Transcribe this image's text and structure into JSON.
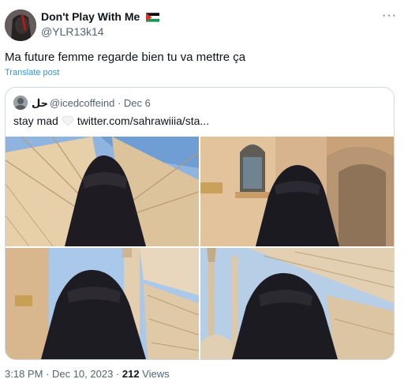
{
  "author": {
    "display_name": "Don't Play With Me",
    "flag_icon": "palestine-flag-icon",
    "handle": "@YLR13k14"
  },
  "more_icon": "ellipsis-icon",
  "more_label": "···",
  "tweet": {
    "text": "Ma future femme regarde bien tu va mettre ça",
    "translate_label": "Translate post"
  },
  "quote": {
    "name": "حل",
    "handle_date": "@icedcoffeind · Dec 6",
    "text_before": "stay mad",
    "heart_icon": "white-heart-icon",
    "text_after": "twitter.com/sahrawiiia/sta...",
    "media": [
      {
        "scene": "niqab-under-umbrellas"
      },
      {
        "scene": "niqab-by-mosque-facade"
      },
      {
        "scene": "niqab-minaret-sky"
      },
      {
        "scene": "niqab-minarets-umbrellas"
      }
    ]
  },
  "meta": {
    "time_date": "3:18 PM · Dec 10, 2023 · ",
    "views_count": "212",
    "views_label": " Views"
  },
  "colors": {
    "text": "#0f1419",
    "secondary": "#536471",
    "link": "#1d9bf0",
    "border": "#cfd9de"
  }
}
